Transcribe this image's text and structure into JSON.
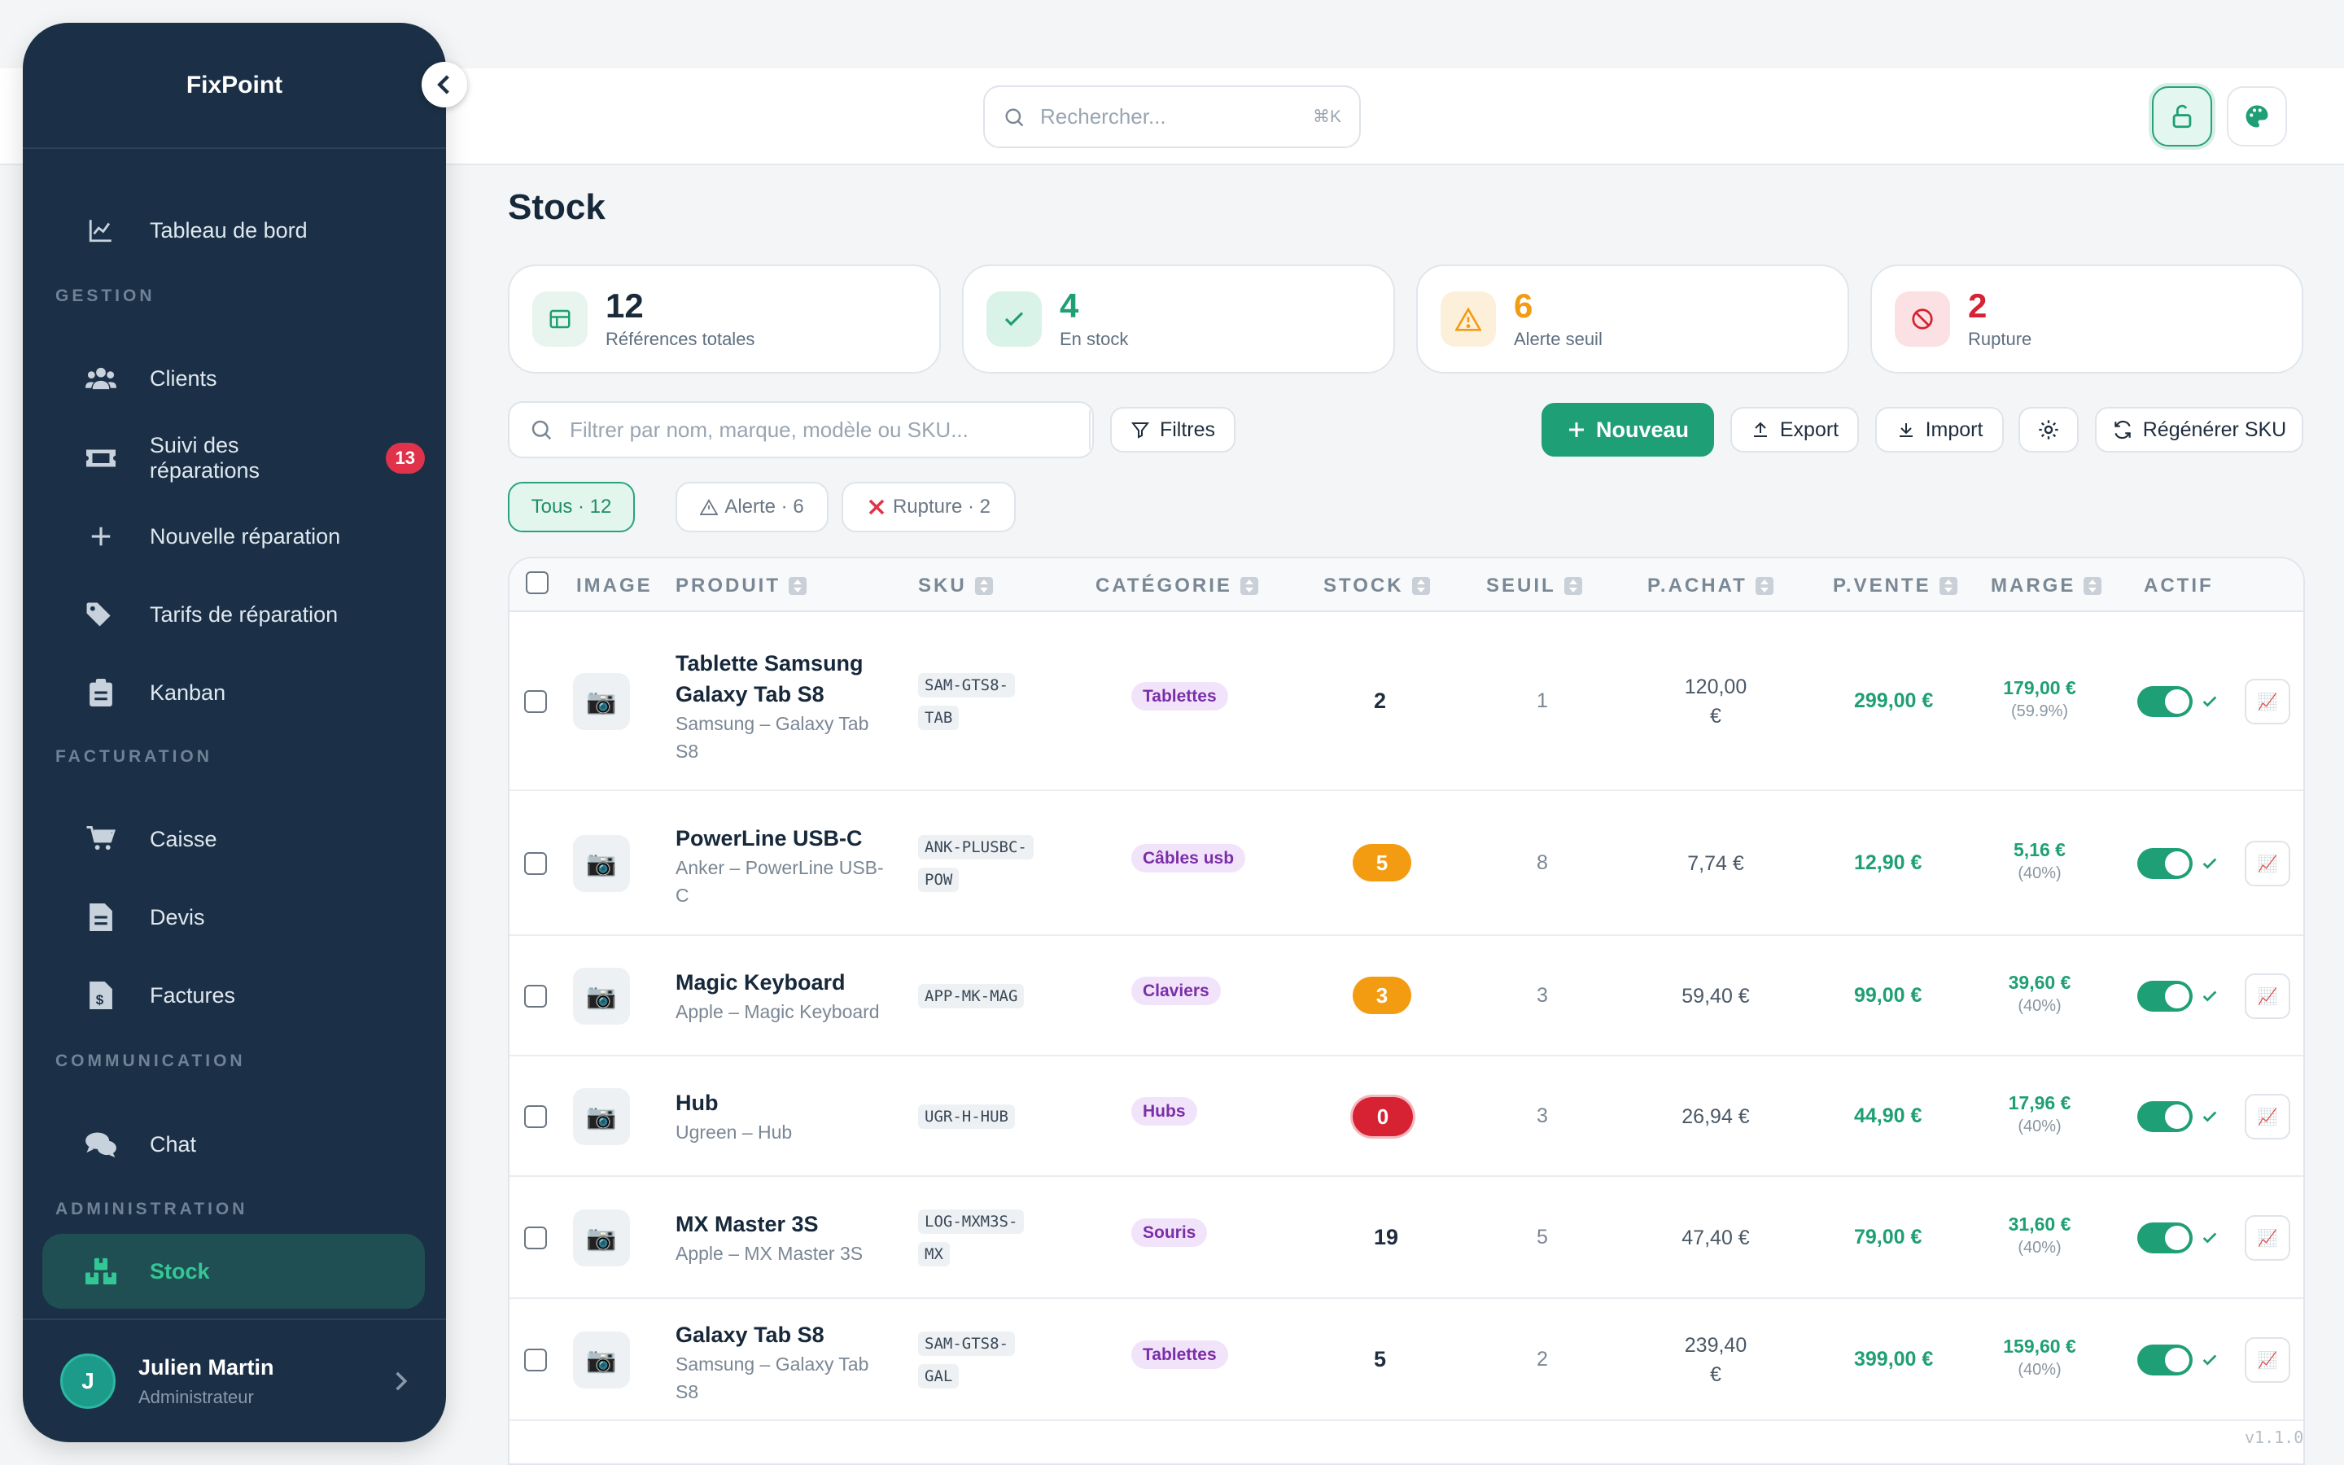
{
  "app": {
    "brand": "FixPoint",
    "version": "v1.1.0"
  },
  "search": {
    "placeholder": "Rechercher...",
    "shortcut": "⌘K"
  },
  "sidebar": {
    "dashboard": "Tableau de bord",
    "sections": {
      "gestion": "GESTION",
      "facturation": "FACTURATION",
      "communication": "COMMUNICATION",
      "administration": "ADMINISTRATION"
    },
    "items": {
      "clients": "Clients",
      "repairs": "Suivi des réparations",
      "repairs_badge": "13",
      "new_repair": "Nouvelle réparation",
      "tariffs": "Tarifs de réparation",
      "kanban": "Kanban",
      "caisse": "Caisse",
      "devis": "Devis",
      "factures": "Factures",
      "chat": "Chat",
      "stock": "Stock"
    },
    "user": {
      "initial": "J",
      "name": "Julien Martin",
      "role": "Administrateur"
    }
  },
  "page": {
    "title": "Stock"
  },
  "stats": [
    {
      "value": "12",
      "label": "Références totales",
      "color": "#1f2d3d"
    },
    {
      "value": "4",
      "label": "En stock",
      "color": "#1f9f76"
    },
    {
      "value": "6",
      "label": "Alerte seuil",
      "color": "#f39c12"
    },
    {
      "value": "2",
      "label": "Rupture",
      "color": "#d62232"
    }
  ],
  "toolbar": {
    "filter_placeholder": "Filtrer par nom, marque, modèle ou SKU...",
    "filters": "Filtres",
    "new": "Nouveau",
    "export": "Export",
    "import": "Import",
    "regen": "Régénérer SKU"
  },
  "chips": {
    "all": "Tous · 12",
    "alert": "Alerte · 6",
    "out": "Rupture · 2"
  },
  "columns": {
    "image": "IMAGE",
    "produit": "PRODUIT",
    "sku": "SKU",
    "categorie": "CATÉGORIE",
    "stock": "STOCK",
    "seuil": "SEUIL",
    "achat": "P.ACHAT",
    "vente": "P.VENTE",
    "marge": "MARGE",
    "actif": "ACTIF"
  },
  "rows": [
    {
      "name1": "Tablette Samsung",
      "name2": "Galaxy Tab S8",
      "sub1": "Samsung – Galaxy Tab",
      "sub2": "S8",
      "sku1": "SAM-GTS8-",
      "sku2": "TAB",
      "cat": "Tablettes",
      "stock": "2",
      "stock_style": "plain",
      "seuil": "1",
      "achat1": "120,00",
      "achat2": "€",
      "vente": "299,00 €",
      "marge": "179,00 €",
      "pct": "(59.9%)"
    },
    {
      "name1": "PowerLine USB-C",
      "name2": "",
      "sub1": "Anker – PowerLine USB-",
      "sub2": "C",
      "sku1": "ANK-PLUSBC-",
      "sku2": "POW",
      "cat": "Câbles usb",
      "stock": "5",
      "stock_style": "orange",
      "seuil": "8",
      "achat1": "7,74 €",
      "achat2": "",
      "vente": "12,90 €",
      "marge": "5,16 €",
      "pct": "(40%)"
    },
    {
      "name1": "Magic Keyboard",
      "name2": "",
      "sub1": "Apple – Magic Keyboard",
      "sub2": "",
      "sku1": "APP-MK-MAG",
      "sku2": "",
      "cat": "Claviers",
      "stock": "3",
      "stock_style": "orange",
      "seuil": "3",
      "achat1": "59,40 €",
      "achat2": "",
      "vente": "99,00 €",
      "marge": "39,60 €",
      "pct": "(40%)"
    },
    {
      "name1": "Hub",
      "name2": "",
      "sub1": "Ugreen – Hub",
      "sub2": "",
      "sku1": "UGR-H-HUB",
      "sku2": "",
      "cat": "Hubs",
      "stock": "0",
      "stock_style": "red",
      "seuil": "3",
      "achat1": "26,94 €",
      "achat2": "",
      "vente": "44,90 €",
      "marge": "17,96 €",
      "pct": "(40%)"
    },
    {
      "name1": "MX Master 3S",
      "name2": "",
      "sub1": "Apple – MX Master 3S",
      "sub2": "",
      "sku1": "LOG-MXM3S-",
      "sku2": "MX",
      "cat": "Souris",
      "stock": "19",
      "stock_style": "plain",
      "seuil": "5",
      "achat1": "47,40 €",
      "achat2": "",
      "vente": "79,00 €",
      "marge": "31,60 €",
      "pct": "(40%)"
    },
    {
      "name1": "Galaxy Tab S8",
      "name2": "",
      "sub1": "Samsung – Galaxy Tab",
      "sub2": "S8",
      "sku1": "SAM-GTS8-",
      "sku2": "GAL",
      "cat": "Tablettes",
      "stock": "5",
      "stock_style": "plain",
      "seuil": "2",
      "achat1": "239,40",
      "achat2": "€",
      "vente": "399,00 €",
      "marge": "159,60 €",
      "pct": "(40%)"
    }
  ]
}
